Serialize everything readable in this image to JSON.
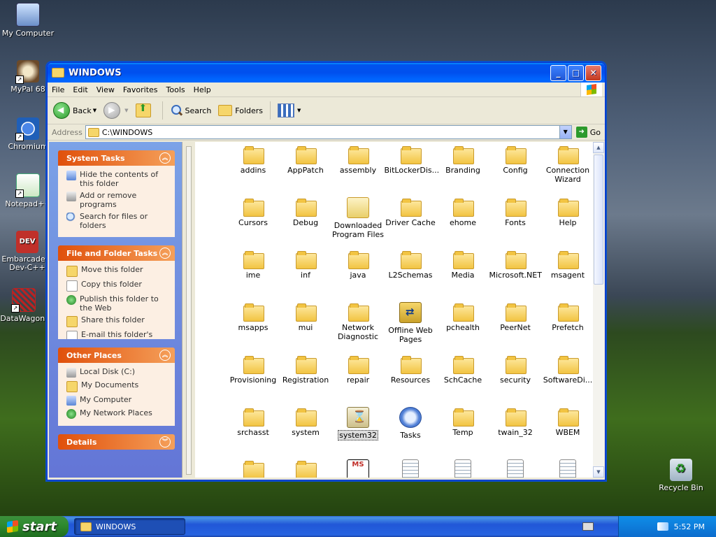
{
  "desktop": {
    "icons": [
      {
        "label": "My Computer"
      },
      {
        "label": "MyPal 68"
      },
      {
        "label": "Chromium"
      },
      {
        "label": "Notepad++"
      },
      {
        "label": "Embarcadero Dev-C++"
      },
      {
        "label": "DataWagon."
      },
      {
        "label": "Recycle Bin"
      }
    ],
    "dev_icon_text": "DEV"
  },
  "window": {
    "title": "WINDOWS",
    "menu": [
      "File",
      "Edit",
      "View",
      "Favorites",
      "Tools",
      "Help"
    ],
    "toolbar": {
      "back_label": "Back",
      "search_label": "Search",
      "folders_label": "Folders"
    },
    "address": {
      "label": "Address",
      "value": "C:\\WINDOWS",
      "go_label": "Go"
    },
    "left_pane": {
      "system_tasks": {
        "title": "System Tasks",
        "items": [
          "Hide the contents of this folder",
          "Add or remove programs",
          "Search for files or folders"
        ]
      },
      "file_folder_tasks": {
        "title": "File and Folder Tasks",
        "items": [
          "Move this folder",
          "Copy this folder",
          "Publish this folder to the Web",
          "Share this folder",
          "E-mail this folder's files"
        ]
      },
      "other_places": {
        "title": "Other Places",
        "items": [
          "Local Disk (C:)",
          "My Documents",
          "My Computer",
          "My Network Places"
        ]
      },
      "details": {
        "title": "Details"
      }
    },
    "items": [
      {
        "name": "addins",
        "icon": "folder"
      },
      {
        "name": "AppPatch",
        "icon": "folder"
      },
      {
        "name": "assembly",
        "icon": "folder"
      },
      {
        "name": "BitLockerDis...",
        "icon": "folder"
      },
      {
        "name": "Branding",
        "icon": "folder"
      },
      {
        "name": "Config",
        "icon": "folder"
      },
      {
        "name": "Connection Wizard",
        "icon": "folder"
      },
      {
        "name": "Cursors",
        "icon": "folder"
      },
      {
        "name": "Debug",
        "icon": "folder"
      },
      {
        "name": "Downloaded Program Files",
        "icon": "special-folder"
      },
      {
        "name": "Driver Cache",
        "icon": "folder"
      },
      {
        "name": "ehome",
        "icon": "folder"
      },
      {
        "name": "Fonts",
        "icon": "folder"
      },
      {
        "name": "Help",
        "icon": "folder"
      },
      {
        "name": "ime",
        "icon": "folder"
      },
      {
        "name": "inf",
        "icon": "folder"
      },
      {
        "name": "java",
        "icon": "folder"
      },
      {
        "name": "L2Schemas",
        "icon": "folder"
      },
      {
        "name": "Media",
        "icon": "folder"
      },
      {
        "name": "Microsoft.NET",
        "icon": "folder"
      },
      {
        "name": "msagent",
        "icon": "folder"
      },
      {
        "name": "msapps",
        "icon": "folder"
      },
      {
        "name": "mui",
        "icon": "folder"
      },
      {
        "name": "Network Diagnostic",
        "icon": "folder"
      },
      {
        "name": "Offline Web Pages",
        "icon": "offline-folder"
      },
      {
        "name": "pchealth",
        "icon": "folder"
      },
      {
        "name": "PeerNet",
        "icon": "folder"
      },
      {
        "name": "Prefetch",
        "icon": "folder"
      },
      {
        "name": "Provisioning",
        "icon": "folder"
      },
      {
        "name": "Registration",
        "icon": "folder"
      },
      {
        "name": "repair",
        "icon": "folder"
      },
      {
        "name": "Resources",
        "icon": "folder"
      },
      {
        "name": "SchCache",
        "icon": "folder"
      },
      {
        "name": "security",
        "icon": "folder"
      },
      {
        "name": "SoftwareDi...",
        "icon": "folder"
      },
      {
        "name": "srchasst",
        "icon": "folder"
      },
      {
        "name": "system",
        "icon": "folder"
      },
      {
        "name": "system32",
        "icon": "system-folder",
        "selected": true
      },
      {
        "name": "Tasks",
        "icon": "tasks-folder"
      },
      {
        "name": "Temp",
        "icon": "folder"
      },
      {
        "name": "twain_32",
        "icon": "folder"
      },
      {
        "name": "WBEM",
        "icon": "folder"
      },
      {
        "name": "",
        "icon": "folder"
      },
      {
        "name": "",
        "icon": "folder"
      },
      {
        "name": "",
        "icon": "ms-file"
      },
      {
        "name": "",
        "icon": "document"
      },
      {
        "name": "",
        "icon": "document"
      },
      {
        "name": "",
        "icon": "document"
      },
      {
        "name": "",
        "icon": "document"
      }
    ],
    "ms_file_text": "MS"
  },
  "taskbar": {
    "start_label": "start",
    "window_button": "WINDOWS",
    "clock": "5:52 PM"
  }
}
